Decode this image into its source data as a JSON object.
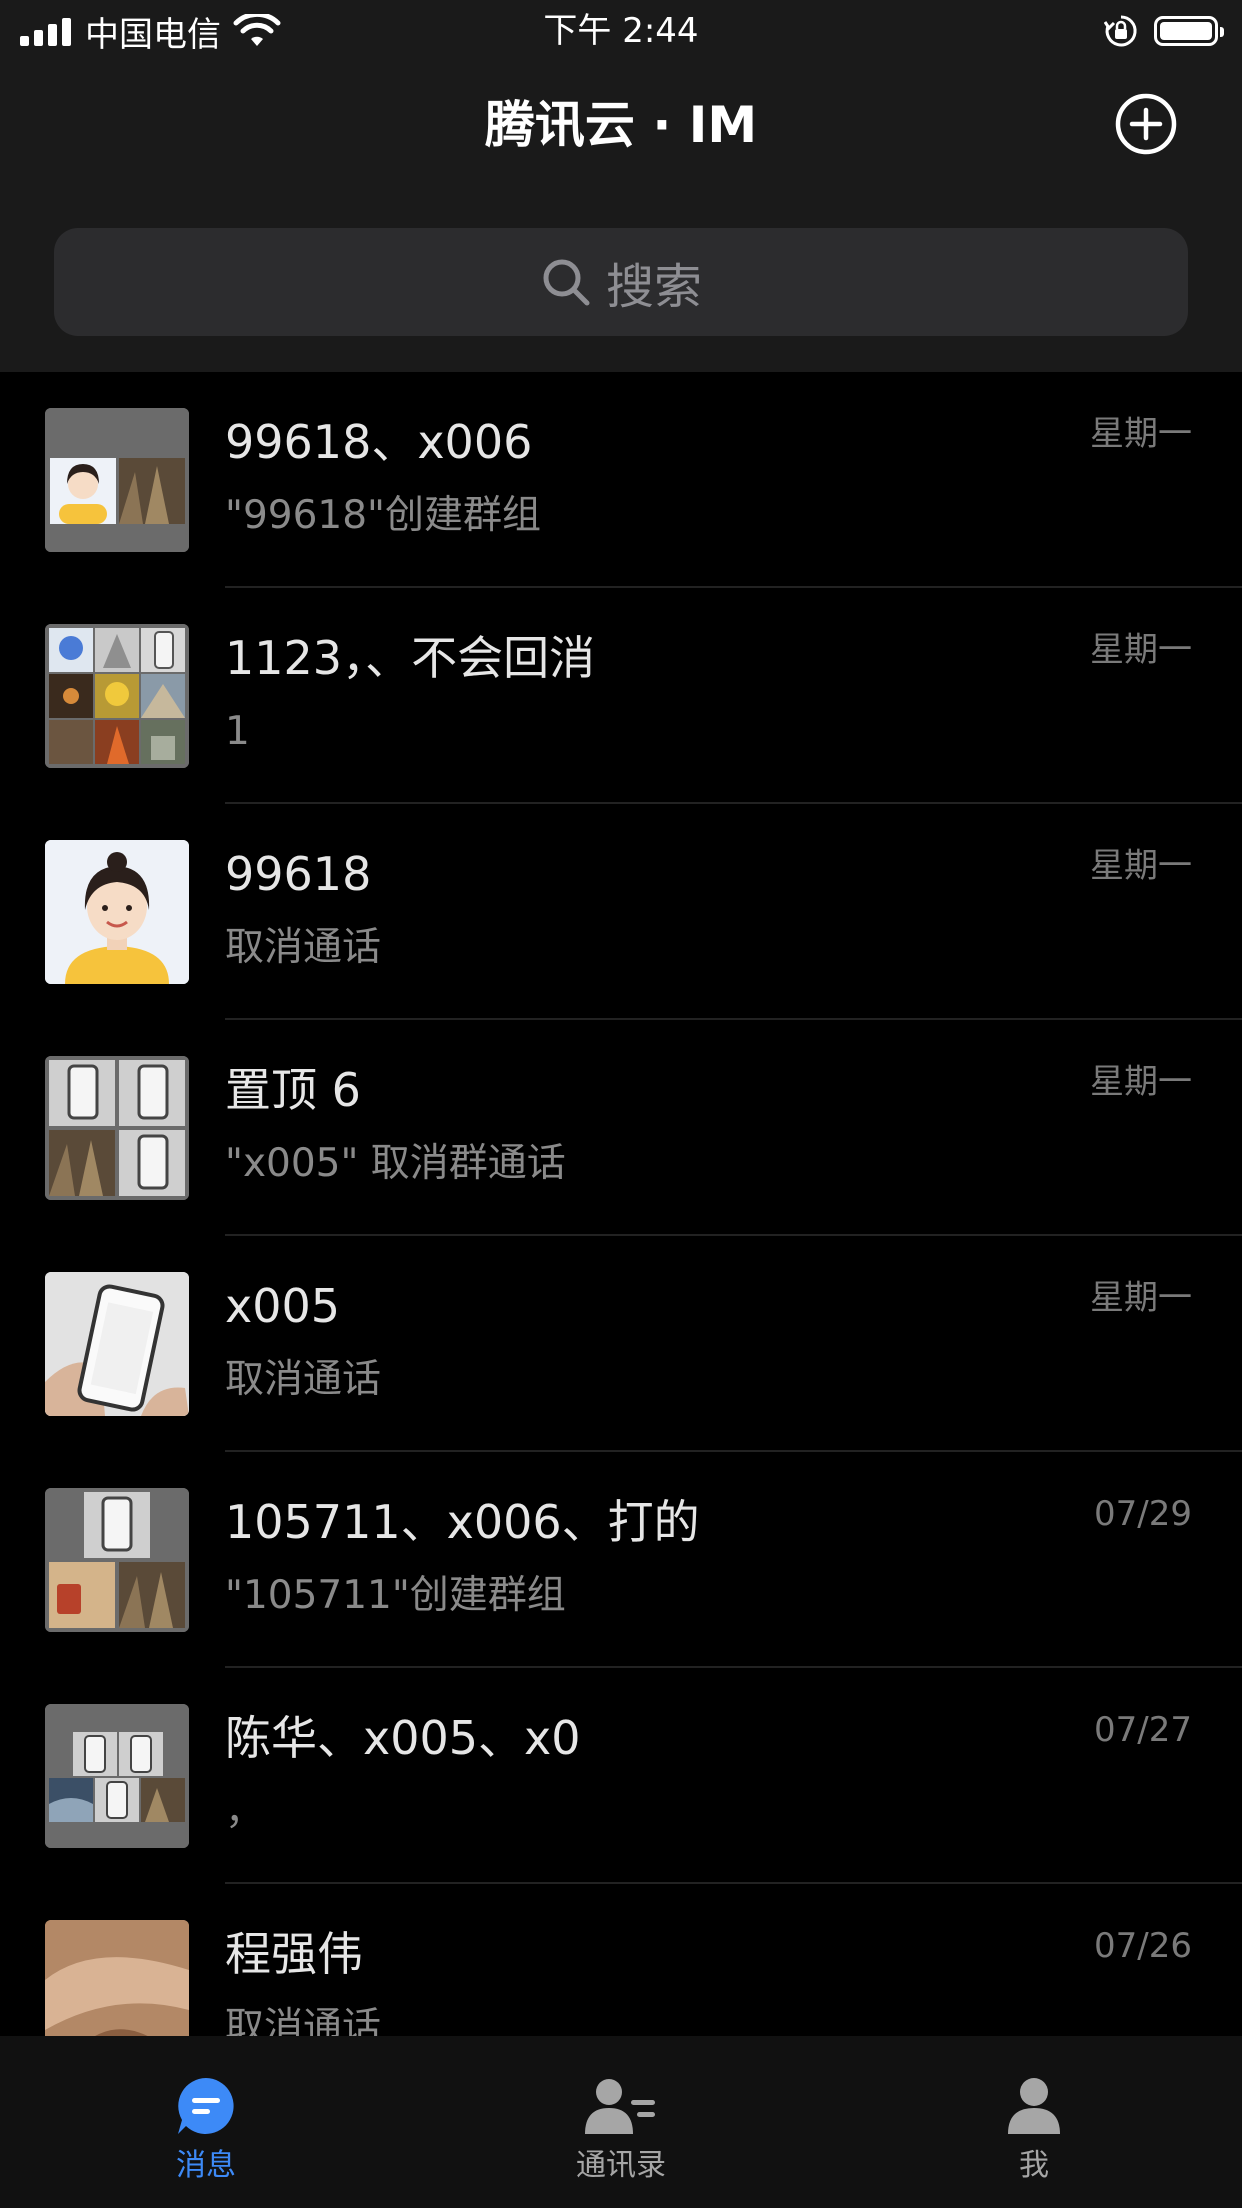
{
  "status_bar": {
    "carrier": "中国电信",
    "time": "下午 2:44"
  },
  "header": {
    "title": "腾讯云 · IM"
  },
  "search": {
    "placeholder": "搜索"
  },
  "conversations": [
    {
      "name": "99618、x006",
      "last_message": "\"99618\"创建群组",
      "time": "星期一",
      "avatar": "group-avatar"
    },
    {
      "name": "1123，、不会回消",
      "last_message": "1",
      "time": "星期一",
      "avatar": "group-avatar"
    },
    {
      "name": "99618",
      "last_message": "取消通话",
      "time": "星期一",
      "avatar": "user-avatar"
    },
    {
      "name": "置顶 6",
      "last_message": "\"x005\" 取消群通话",
      "time": "星期一",
      "avatar": "group-avatar"
    },
    {
      "name": "x005",
      "last_message": "取消通话",
      "time": "星期一",
      "avatar": "user-avatar"
    },
    {
      "name": "105711、x006、打的",
      "last_message": "\"105711\"创建群组",
      "time": "07/29",
      "avatar": "group-avatar"
    },
    {
      "name": "陈华、x005、x0",
      "last_message": "，",
      "time": "07/27",
      "avatar": "group-avatar"
    },
    {
      "name": "程强伟",
      "last_message": "取消通话",
      "time": "07/26",
      "avatar": "user-avatar"
    }
  ],
  "tabs": [
    {
      "label": "消息",
      "icon": "message-icon",
      "active": true
    },
    {
      "label": "通讯录",
      "icon": "contacts-icon",
      "active": false
    },
    {
      "label": "我",
      "icon": "profile-icon",
      "active": false
    }
  ],
  "colors": {
    "background": "#000000",
    "header_background": "#1a1a1a",
    "accent": "#3d8af7",
    "secondary_text": "#8a8a8a"
  }
}
